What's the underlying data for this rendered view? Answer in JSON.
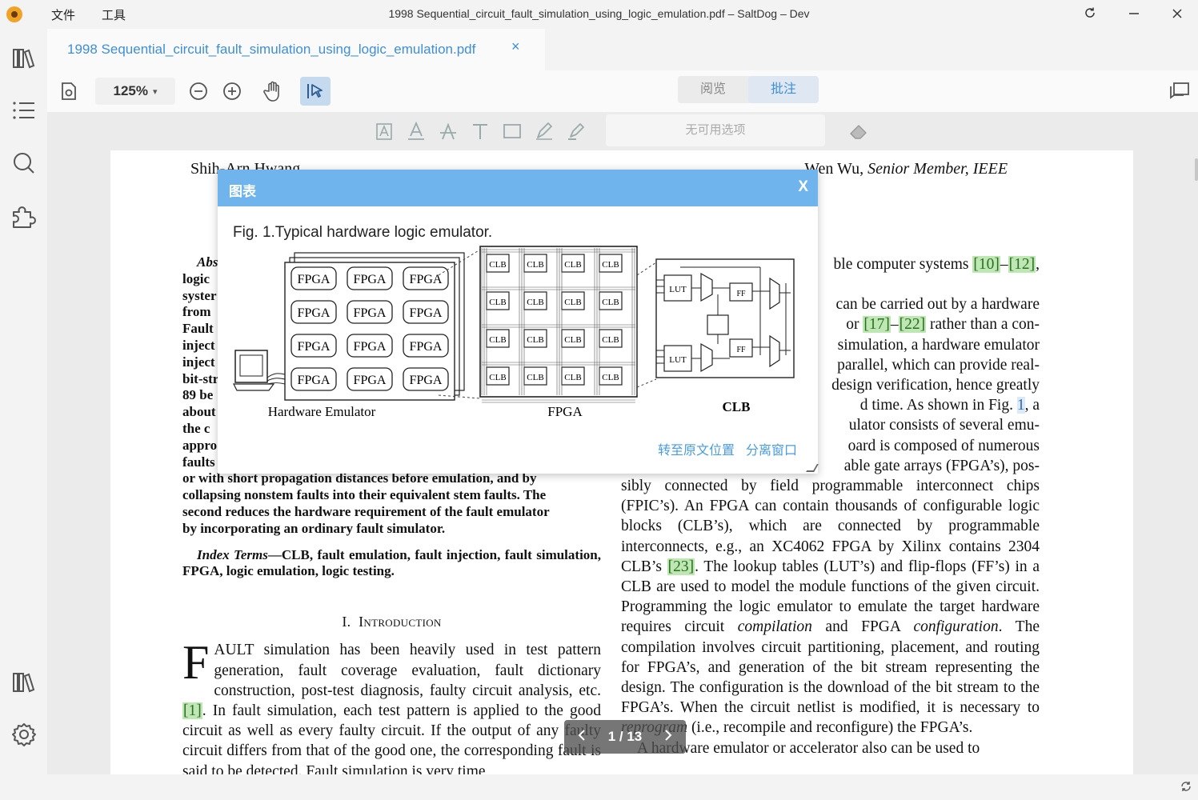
{
  "titlebar": {
    "menu": [
      "文件",
      "工具"
    ],
    "title": "1998 Sequential_circuit_fault_simulation_using_logic_emulation.pdf – SaltDog – Dev"
  },
  "tab": {
    "label": "1998 Sequential_circuit_fault_simulation_using_logic_emulation.pdf",
    "close": "×"
  },
  "toolbar": {
    "zoom": "125%",
    "modes": [
      "阅览",
      "批注"
    ],
    "active_mode": "批注"
  },
  "annotation_bar": {
    "no_options": "无可用选项"
  },
  "document": {
    "authors_left": "Shih-Arn Hwang, ",
    "authors_right": "Wen Wu, ",
    "authors_title": "Senior Member, IEEE",
    "abstract_stubs": [
      "Abs",
      "logic",
      "syster",
      "from",
      "Fault",
      "inject",
      "inject",
      "bit-str",
      "89 be",
      "about",
      "the c",
      "appro",
      "faults"
    ],
    "abstract_tail": [
      "or with short propagation distances before emulation, and by",
      "collapsing nonstem faults into their equivalent stem faults. The",
      "second reduces the hardware requirement of the fault emulator",
      "by incorporating an ordinary fault simulator."
    ],
    "index_terms_label": "Index Terms",
    "index_terms": "—CLB, fault emulation, fault injection, fault simulation, FPGA, logic emulation, logic testing.",
    "section_number": "I.",
    "section_title": "Introduction",
    "intro_dropcap": "F",
    "intro_first": "AULT simulation has been heavily used in test pattern generation, fault coverage evaluation, fault dictionary construction, post-test diagnosis, faulty circuit analysis, etc.",
    "intro_cite": "[1]",
    "intro_rest": ". In fault simulation, each test pattern is applied to the good circuit as well as every faulty circuit. If the output of any faulty circuit differs from that of the good one, the corresponding fault is said to be detected. Fault simulation is very time",
    "right_line1": "ble computer systems ",
    "right_cite1a": "[10]",
    "right_cite1b": "[12]",
    "right_stubs": [
      "can be carried out by a hardware",
      "or ",
      "simulation, a hardware emulator",
      "parallel, which can provide real-",
      "design verification, hence greatly",
      "d time. As shown in Fig. ",
      "ulator consists of several emu-",
      "oard is composed of numerous",
      "able gate arrays (FPGA’s), pos-"
    ],
    "right_cite2a": "[17]",
    "right_cite2b": "[22]",
    "right_stub2_tail": " rather than a con-",
    "right_figref": "1",
    "right_figref_tail": ", a",
    "right_para1": "sibly connected by field programmable interconnect chips (FPIC’s). An FPGA can contain thousands of configurable logic blocks (CLB’s), which are connected by programmable interconnects, e.g., an XC4062 FPGA by Xilinx contains 2304 CLB’s ",
    "right_cite3": "[23]",
    "right_para1b": ". The lookup tables (LUT’s) and flip-flops (FF’s) in a CLB are used to model the module functions of the given circuit. Programming the logic emulator to emulate the target hardware requires circuit ",
    "right_em1": "compilation",
    "right_para1c": " and FPGA ",
    "right_em2": "configuration",
    "right_para1d": ". The compilation involves circuit partitioning, placement, and routing for FPGA’s, and generation of the bit stream representing the design. The configuration is the download of the bit stream to the FPGA’s. When the circuit netlist is modified, it is necessary to ",
    "right_em3": "reprogram",
    "right_para1e": " (i.e., recompile and reconfigure) the FPGA’s.",
    "right_para2": "A hardware emulator or accelerator also can be used to"
  },
  "page_nav": {
    "indicator": "1 / 13"
  },
  "figure_popup": {
    "title": "图表",
    "close": "X",
    "caption": "Fig. 1.Typical hardware logic emulator.",
    "fpga_label": "FPGA",
    "clb_label": "CLB",
    "lut_label": "LUT",
    "ff_label": "FF",
    "labels": [
      "Hardware Emulator",
      "FPGA",
      "CLB"
    ],
    "goto_link": "转至原文位置",
    "detach_link": "分离窗口"
  }
}
